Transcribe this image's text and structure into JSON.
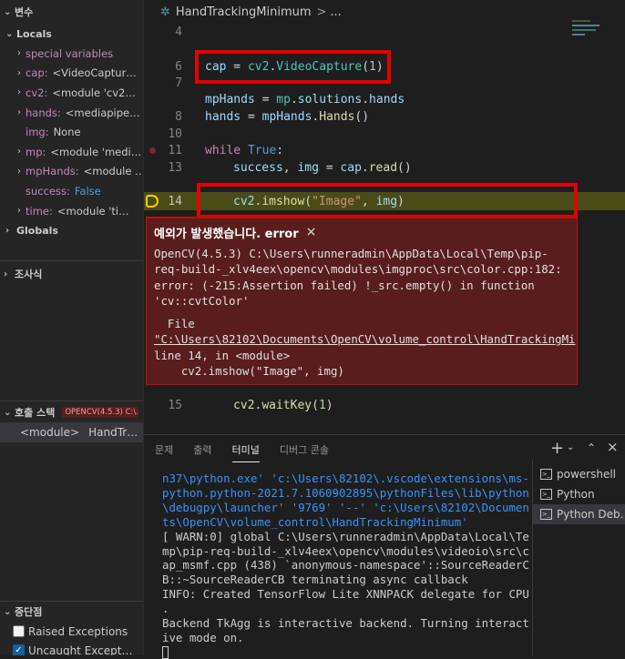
{
  "sidebar": {
    "variables_title": "변수",
    "locals_title": "Locals",
    "locals": [
      {
        "name": "special variables",
        "value": "",
        "expandable": true
      },
      {
        "name": "cap:",
        "value": "<VideoCaptur…",
        "expandable": true
      },
      {
        "name": "cv2:",
        "value": "<module 'cv2…",
        "expandable": true
      },
      {
        "name": "hands:",
        "value": "<mediapipe…",
        "expandable": true
      },
      {
        "name": "img:",
        "value": "None",
        "expandable": false
      },
      {
        "name": "mp:",
        "value": "<module 'medi…",
        "expandable": true
      },
      {
        "name": "mpHands:",
        "value": "<module …",
        "expandable": true
      },
      {
        "name": "success:",
        "value": "False",
        "expandable": false
      },
      {
        "name": "time:",
        "value": "<module 'ti…",
        "expandable": true
      }
    ],
    "globals_title": "Globals",
    "watch_title": "조사식",
    "callstack_title": "호출 스택",
    "callstack_badge": "OPENCV(4.5.3) C:\\...",
    "callstack_frame_name": "<module>",
    "callstack_frame_file": "HandTr…",
    "breakpoints_title": "중단점",
    "breakpoints": [
      {
        "label": "Raised Exceptions",
        "checked": false
      },
      {
        "label": "Uncaught Except…",
        "checked": true
      }
    ]
  },
  "editor": {
    "breadcrumb": "HandTrackingMinimum",
    "breadcrumb_sep": ">",
    "breadcrumb_more": "...",
    "line_numbers": [
      "4",
      "6",
      "7",
      "8",
      "10",
      "11",
      "13",
      "14",
      "15"
    ],
    "code": {
      "l6": [
        "cap",
        " = ",
        "cv2",
        ".",
        "VideoCapture",
        "(",
        "1",
        ")"
      ],
      "l7": [
        "mpHands",
        " = ",
        "mp",
        ".",
        "solutions",
        ".",
        "hands"
      ],
      "l8": [
        "hands",
        " = ",
        "mpHands",
        ".",
        "Hands",
        "()"
      ],
      "l11": [
        "while",
        " ",
        "True",
        ":"
      ],
      "l13": [
        "success",
        ", ",
        "img",
        " = ",
        "cap",
        ".",
        "read",
        "()"
      ],
      "l14": [
        "cv2",
        ".",
        "imshow",
        "(",
        "\"Image\"",
        ", ",
        "img",
        ")"
      ],
      "l15": [
        "cv2",
        ".",
        "waitKey",
        "(",
        "1",
        ")"
      ]
    },
    "error": {
      "title": "예외가 발생했습니다. error",
      "lines": [
        "OpenCV(4.5.3) C:\\Users\\runneradmin\\AppData\\Local\\Temp\\pip-",
        "req-build-_xlv4eex\\opencv\\modules\\imgproc\\src\\color.cpp:182:",
        "error: (-215:Assertion failed) !_src.empty() in function",
        "'cv::cvtColor'"
      ],
      "file_label": "  File",
      "file_path": "\"C:\\Users\\82102\\Documents\\OpenCV\\volume_control\\HandTrackingMi",
      "line_info": "line 14, in <module>",
      "code_line": "    cv2.imshow(\"Image\", img)"
    }
  },
  "panel": {
    "tabs": [
      "문제",
      "출력",
      "터미널",
      "디버그 콘솔"
    ],
    "active_tab": "터미널",
    "terminal_lines_blue": [
      "n37\\python.exe' 'c:\\Users\\82102\\.vscode\\extensions\\ms-",
      "python.python-2021.7.1060902895\\pythonFiles\\lib\\python",
      "\\debugpy\\launcher' '9769' '--' 'c:\\Users\\82102\\Documen",
      "ts\\OpenCV\\volume_control\\HandTrackingMinimum'"
    ],
    "terminal_lines": [
      "[ WARN:0] global C:\\Users\\runneradmin\\AppData\\Local\\Te",
      "mp\\pip-req-build-_xlv4eex\\opencv\\modules\\videoio\\src\\c",
      "ap_msmf.cpp (438) `anonymous-namespace'::SourceReaderC",
      "B::~SourceReaderCB terminating async callback",
      "INFO: Created TensorFlow Lite XNNPACK delegate for CPU",
      ".",
      "Backend TkAgg is interactive backend. Turning interact",
      "ive mode on."
    ],
    "terminals": [
      {
        "label": "powershell",
        "active": false
      },
      {
        "label": "Python",
        "active": false
      },
      {
        "label": "Python Deb…",
        "active": true
      }
    ]
  },
  "colors": {
    "highlight": "#e60000",
    "current_line": "#4b4b18",
    "error_bg": "#5a1d1d"
  }
}
